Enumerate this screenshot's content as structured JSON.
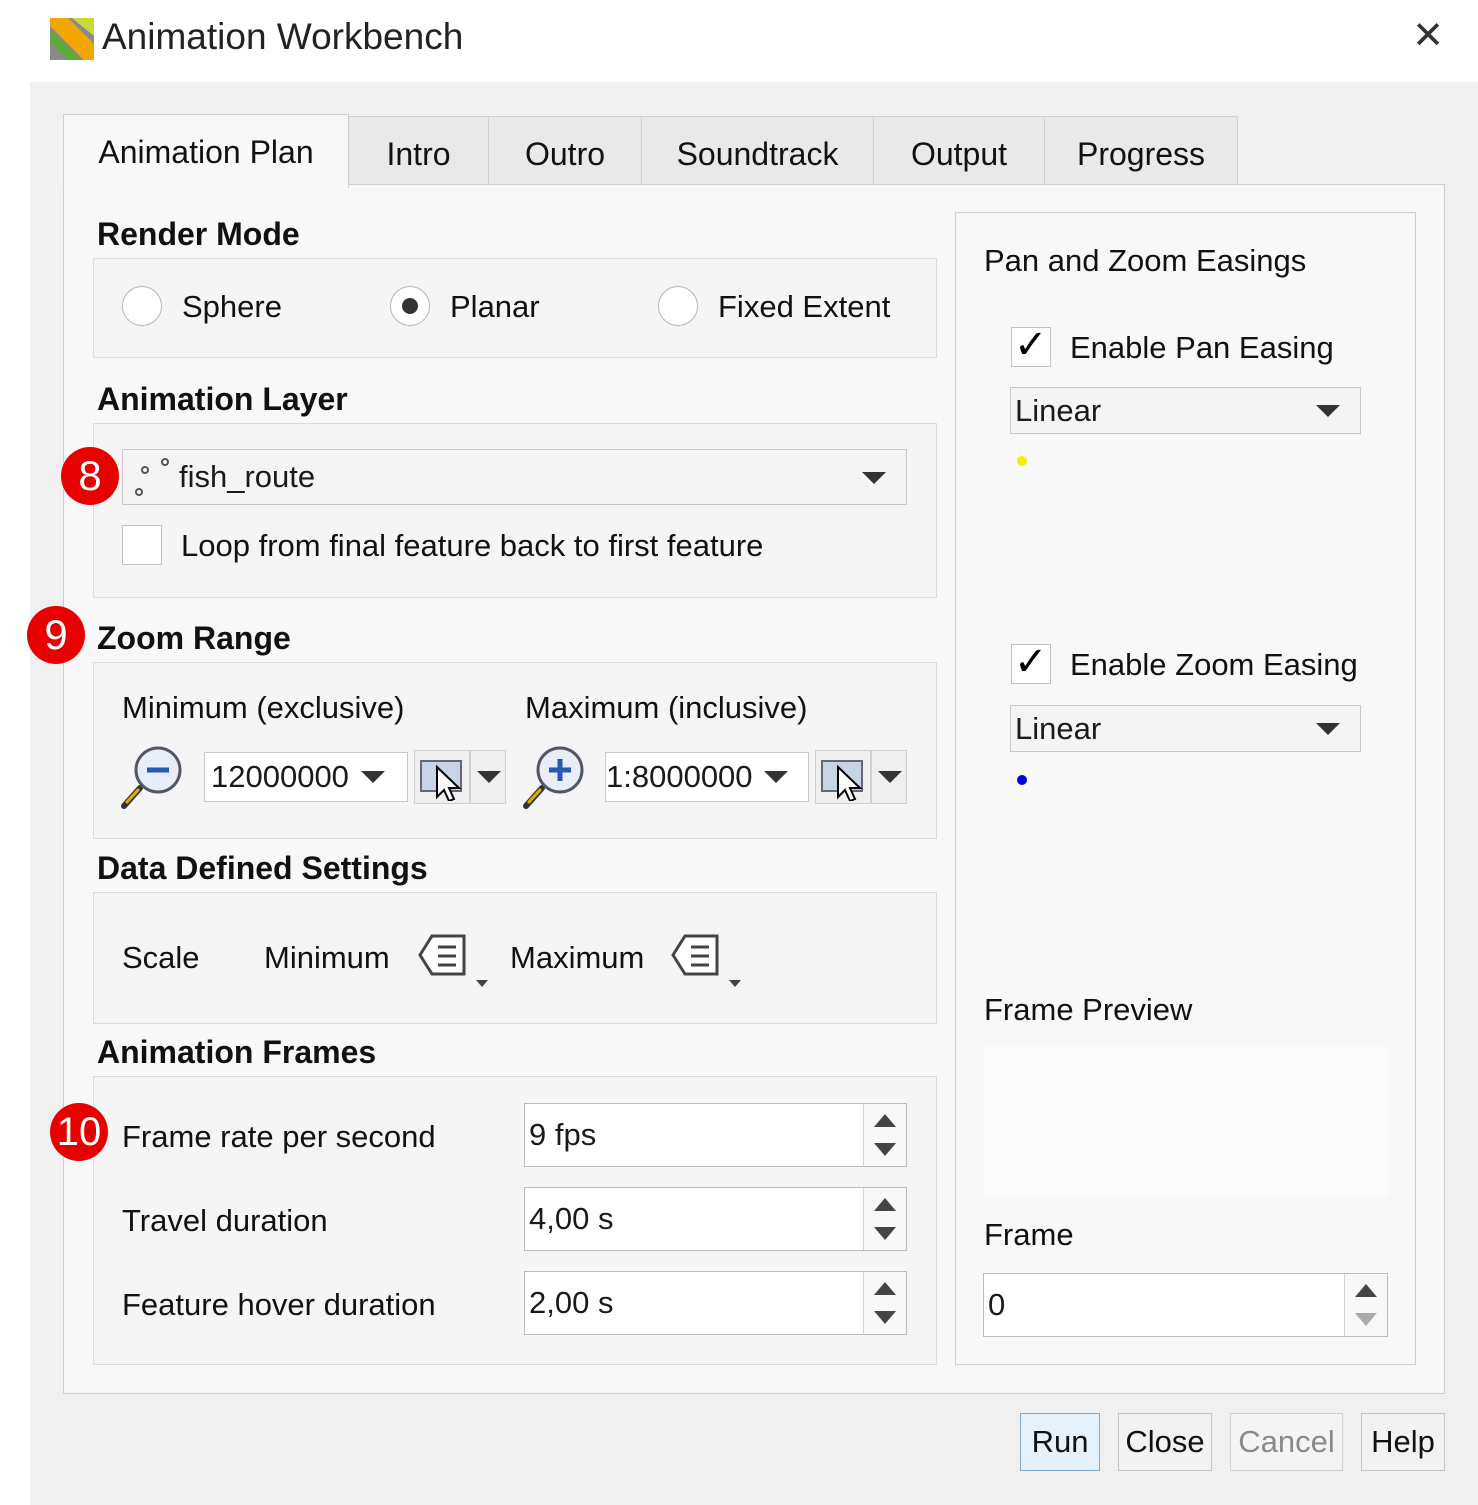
{
  "window": {
    "title": "Animation Workbench",
    "close_symbol": "✕"
  },
  "tabs": [
    "Animation Plan",
    "Intro",
    "Outro",
    "Soundtrack",
    "Output",
    "Progress"
  ],
  "render_mode": {
    "heading": "Render Mode",
    "options": [
      "Sphere",
      "Planar",
      "Fixed Extent"
    ],
    "selected": "Planar"
  },
  "animation_layer": {
    "heading": "Animation Layer",
    "layer": "fish_route",
    "loop_label": "Loop from final feature back to first feature",
    "loop_checked": false
  },
  "zoom_range": {
    "heading": "Zoom Range",
    "min_label": "Minimum (exclusive)",
    "max_label": "Maximum (inclusive)",
    "min_value": "12000000",
    "max_value": "1:8000000"
  },
  "data_defined": {
    "heading": "Data Defined Settings",
    "scale_label": "Scale",
    "min_label": "Minimum",
    "max_label": "Maximum"
  },
  "animation_frames": {
    "heading": "Animation Frames",
    "frame_rate_label": "Frame rate per second",
    "frame_rate_value": "9 fps",
    "travel_label": "Travel duration",
    "travel_value": "4,00 s",
    "hover_label": "Feature hover duration",
    "hover_value": "2,00 s"
  },
  "easings": {
    "heading": "Pan and Zoom Easings",
    "pan_label": "Enable Pan Easing",
    "pan_checked": true,
    "pan_easing": "Linear",
    "pan_dot_color": "#f5f000",
    "zoom_label": "Enable Zoom Easing",
    "zoom_checked": true,
    "zoom_easing": "Linear",
    "zoom_dot_color": "#0000dd"
  },
  "preview": {
    "heading": "Frame Preview",
    "frame_label": "Frame",
    "frame_value": "0"
  },
  "badges": [
    "8",
    "9",
    "10"
  ],
  "buttons": {
    "run": "Run",
    "close": "Close",
    "cancel": "Cancel",
    "help": "Help"
  },
  "icons": [
    "app-logo-icon",
    "point-layer-icon",
    "zoom-out-icon",
    "zoom-in-icon",
    "map-canvas-cursor-icon",
    "data-defined-icon",
    "close-icon"
  ]
}
